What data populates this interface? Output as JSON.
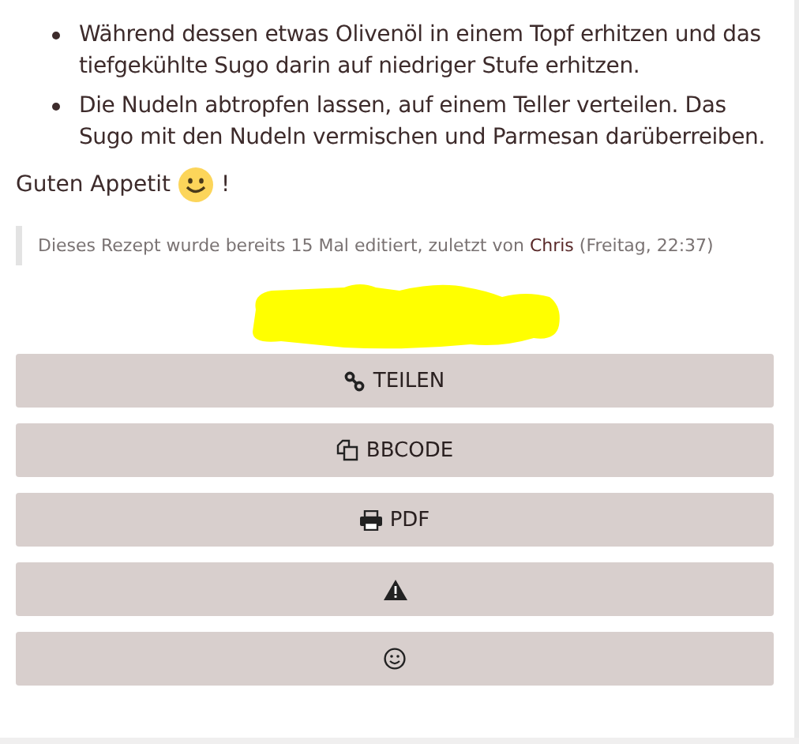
{
  "steps": [
    "Während dessen etwas Olivenöl in einem Topf erhitzen und das tiefgekühlte Sugo darin auf niedriger Stufe erhitzen.",
    "Die Nudeln abtropfen lassen, auf einem Teller verteilen. Das Sugo mit den Nudeln vermischen und Parmesan darüberreiben."
  ],
  "closing": {
    "text": "Guten Appetit",
    "after": "!"
  },
  "edit_note": {
    "text": "Dieses Rezept wurde bereits 15 Mal editiert, zuletzt von",
    "author": "Chris",
    "when": "(Freitag, 22:37)"
  },
  "buttons": [
    {
      "kind": "share",
      "label": "TEILEN"
    },
    {
      "kind": "copy",
      "label": "BBCODE"
    },
    {
      "kind": "print",
      "label": "PDF"
    },
    {
      "kind": "report"
    },
    {
      "kind": "smiley"
    }
  ]
}
